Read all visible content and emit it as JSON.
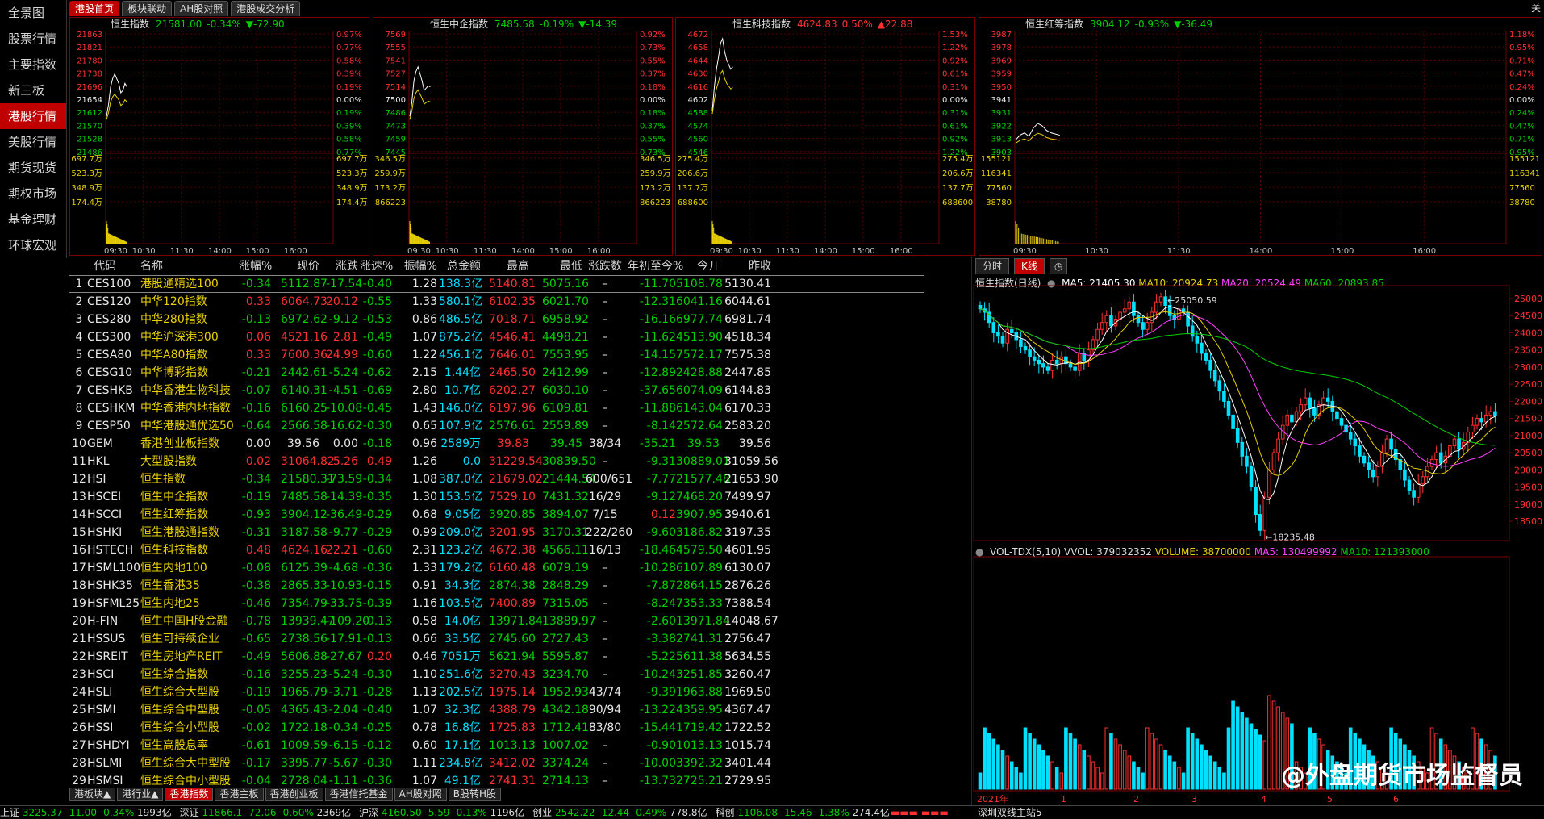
{
  "nav": [
    "全景图",
    "股票行情",
    "主要指数",
    "新三板",
    "港股行情",
    "美股行情",
    "期货现货",
    "期权市场",
    "基金理财",
    "环球宏观"
  ],
  "nav_active": 4,
  "top_tabs": [
    "港股首页",
    "板块联动",
    "AH股对照",
    "港股成交分析"
  ],
  "top_tabs_active": 0,
  "top_right": "关",
  "minis": [
    {
      "name": "恒生指数",
      "last": "21581.00",
      "pct": "-0.34%",
      "chg": "▼-72.90",
      "up": false,
      "prices": [
        "21863",
        "21821",
        "21780",
        "21738",
        "21696",
        "21654",
        "21612",
        "21570",
        "21528",
        "21486"
      ],
      "pcts": [
        "0.97%",
        "0.77%",
        "0.58%",
        "0.39%",
        "0.19%",
        "0.00%",
        "0.19%",
        "0.39%",
        "0.58%",
        "0.77%"
      ],
      "vols": [
        "697.7万",
        "523.3万",
        "348.9万",
        "174.4万"
      ],
      "times": [
        "09:30",
        "10:30",
        "11:30",
        "14:00",
        "15:00",
        "16:00"
      ],
      "line": [
        0.3,
        0.4,
        0.55,
        0.62,
        0.66,
        0.62,
        0.58,
        0.5,
        0.52,
        0.58,
        0.55
      ]
    },
    {
      "name": "恒生中企指数",
      "last": "7485.58",
      "pct": "-0.19%",
      "chg": "▼-14.39",
      "up": false,
      "prices": [
        "7569",
        "7555",
        "7541",
        "7527",
        "7514",
        "7500",
        "7486",
        "7473",
        "7459",
        "7445"
      ],
      "pcts": [
        "0.92%",
        "0.73%",
        "0.55%",
        "0.37%",
        "0.18%",
        "0.00%",
        "0.18%",
        "0.37%",
        "0.55%",
        "0.73%"
      ],
      "vols": [
        "346.5万",
        "259.9万",
        "173.2万",
        "866223"
      ],
      "times": [
        "09:30",
        "10:30",
        "11:30",
        "14:00",
        "15:00",
        "16:00"
      ],
      "line": [
        0.3,
        0.42,
        0.6,
        0.68,
        0.72,
        0.66,
        0.6,
        0.52,
        0.54,
        0.56,
        0.55
      ]
    },
    {
      "name": "恒生科技指数",
      "last": "4624.83",
      "pct": "0.50%",
      "chg": "▲22.88",
      "up": true,
      "prices": [
        "4672",
        "4658",
        "4644",
        "4630",
        "4616",
        "4602",
        "4588",
        "4574",
        "4560",
        "4546"
      ],
      "pcts": [
        "1.53%",
        "1.22%",
        "0.92%",
        "0.61%",
        "0.31%",
        "0.00%",
        "0.31%",
        "0.61%",
        "0.92%",
        "1.22%"
      ],
      "vols": [
        "275.4万",
        "206.6万",
        "137.7万",
        "688600"
      ],
      "times": [
        "09:30",
        "10:30",
        "11:30",
        "14:00",
        "15:00",
        "16:00"
      ],
      "line": [
        0.35,
        0.55,
        0.7,
        0.8,
        0.92,
        0.96,
        0.85,
        0.78,
        0.74,
        0.7,
        0.72
      ]
    },
    {
      "name": "恒生红筹指数",
      "last": "3904.12",
      "pct": "-0.93%",
      "chg": "▼-36.49",
      "up": false,
      "prices": [
        "3987",
        "3978",
        "3969",
        "3959",
        "3950",
        "3941",
        "3931",
        "3922",
        "3913",
        "3903"
      ],
      "pcts": [
        "1.18%",
        "0.95%",
        "0.71%",
        "0.47%",
        "0.24%",
        "0.00%",
        "0.24%",
        "0.47%",
        "0.71%",
        "0.95%"
      ],
      "vols": [
        "155121",
        "116341",
        "77560",
        "38780"
      ],
      "times": [
        "09:30",
        "10:30",
        "11:30",
        "14:00",
        "15:00",
        "16:00"
      ],
      "line": [
        0.1,
        0.14,
        0.16,
        0.13,
        0.2,
        0.24,
        0.22,
        0.18,
        0.16,
        0.15,
        0.14
      ]
    }
  ],
  "table": {
    "headers": [
      "",
      "代码",
      "名称",
      "涨幅%",
      "现价",
      "涨跌",
      "涨速%",
      "振幅%",
      "总金额",
      "最高",
      "最低",
      "涨跌数",
      "年初至今%",
      "今开",
      "昨收"
    ],
    "rows": [
      [
        "1",
        "CES100",
        "港股通精选100",
        "-0.34",
        "5112.87",
        "-17.54",
        "-0.40",
        "1.28",
        "138.3亿",
        "5140.81",
        "5075.16",
        "–",
        "-11.70",
        "5108.78",
        "5130.41"
      ],
      [
        "2",
        "CES120",
        "中华120指数",
        "0.33",
        "6064.73",
        "20.12",
        "-0.55",
        "1.33",
        "580.1亿",
        "6102.35",
        "6021.70",
        "–",
        "-12.31",
        "6041.16",
        "6044.61"
      ],
      [
        "3",
        "CES280",
        "中华280指数",
        "-0.13",
        "6972.62",
        "-9.12",
        "-0.53",
        "0.86",
        "486.5亿",
        "7018.71",
        "6958.92",
        "–",
        "-16.16",
        "6977.74",
        "6981.74"
      ],
      [
        "4",
        "CES300",
        "中华沪深港300",
        "0.06",
        "4521.16",
        "2.81",
        "-0.49",
        "1.07",
        "875.2亿",
        "4546.41",
        "4498.21",
        "–",
        "-11.62",
        "4513.90",
        "4518.34"
      ],
      [
        "5",
        "CESA80",
        "中华A80指数",
        "0.33",
        "7600.36",
        "24.99",
        "-0.60",
        "1.22",
        "456.1亿",
        "7646.01",
        "7553.95",
        "–",
        "-14.15",
        "7572.17",
        "7575.38"
      ],
      [
        "6",
        "CESG10",
        "中华博彩指数",
        "-0.21",
        "2442.61",
        "-5.24",
        "-0.62",
        "2.15",
        "1.44亿",
        "2465.50",
        "2412.99",
        "–",
        "-12.89",
        "2428.88",
        "2447.85"
      ],
      [
        "7",
        "CESHKB",
        "中华香港生物科技",
        "-0.07",
        "6140.31",
        "-4.51",
        "-0.69",
        "2.80",
        "10.7亿",
        "6202.27",
        "6030.10",
        "–",
        "-37.65",
        "6074.09",
        "6144.83"
      ],
      [
        "8",
        "CESHKM",
        "中华香港内地指数",
        "-0.16",
        "6160.25",
        "-10.08",
        "-0.45",
        "1.43",
        "146.0亿",
        "6197.96",
        "6109.81",
        "–",
        "-11.88",
        "6143.04",
        "6170.33"
      ],
      [
        "9",
        "CESP50",
        "中华港股通优选50",
        "-0.64",
        "2566.58",
        "-16.62",
        "-0.30",
        "0.65",
        "107.9亿",
        "2576.61",
        "2559.89",
        "–",
        "-8.14",
        "2572.64",
        "2583.20"
      ],
      [
        "10",
        "GEM",
        "香港创业板指数",
        "0.00",
        "39.56",
        "0.00",
        "-0.18",
        "0.96",
        "2589万",
        "39.83",
        "39.45",
        "38/34",
        "-35.21",
        "39.53",
        "39.56"
      ],
      [
        "11",
        "HKL",
        "大型股指数",
        "0.02",
        "31064.82",
        "5.26",
        "0.49",
        "1.26",
        "0.0",
        "31229.54",
        "30839.50",
        "–",
        "-9.31",
        "30889.01",
        "31059.56"
      ],
      [
        "12",
        "HSI",
        "恒生指数",
        "-0.34",
        "21580.31",
        "-73.59",
        "-0.34",
        "1.08",
        "387.0亿",
        "21679.02",
        "21444.54",
        "600/651",
        "-7.77",
        "21577.48",
        "21653.90"
      ],
      [
        "13",
        "HSCEI",
        "恒生中企指数",
        "-0.19",
        "7485.58",
        "-14.39",
        "-0.35",
        "1.30",
        "153.5亿",
        "7529.10",
        "7431.32",
        "16/29",
        "-9.12",
        "7468.20",
        "7499.97"
      ],
      [
        "14",
        "HSCCI",
        "恒生红筹指数",
        "-0.93",
        "3904.12",
        "-36.49",
        "-0.29",
        "0.68",
        "9.05亿",
        "3920.85",
        "3894.07",
        "7/15",
        "0.12",
        "3907.95",
        "3940.61"
      ],
      [
        "15",
        "HSHKI",
        "恒生港股通指数",
        "-0.31",
        "3187.58",
        "-9.77",
        "-0.29",
        "0.99",
        "209.0亿",
        "3201.95",
        "3170.31",
        "222/260",
        "-9.60",
        "3186.82",
        "3197.35"
      ],
      [
        "16",
        "HSTECH",
        "恒生科技指数",
        "0.48",
        "4624.16",
        "22.21",
        "-0.60",
        "2.31",
        "123.2亿",
        "4672.38",
        "4566.11",
        "16/13",
        "-18.46",
        "4579.50",
        "4601.95"
      ],
      [
        "17",
        "HSML100",
        "恒生内地100",
        "-0.08",
        "6125.39",
        "-4.68",
        "-0.36",
        "1.33",
        "179.2亿",
        "6160.48",
        "6079.19",
        "–",
        "-10.28",
        "6107.89",
        "6130.07"
      ],
      [
        "18",
        "HSHK35",
        "恒生香港35",
        "-0.38",
        "2865.33",
        "-10.93",
        "-0.15",
        "0.91",
        "34.3亿",
        "2874.38",
        "2848.29",
        "–",
        "-7.87",
        "2864.15",
        "2876.26"
      ],
      [
        "19",
        "HSFML25",
        "恒生内地25",
        "-0.46",
        "7354.79",
        "-33.75",
        "-0.39",
        "1.16",
        "103.5亿",
        "7400.89",
        "7315.05",
        "–",
        "-8.24",
        "7353.33",
        "7388.54"
      ],
      [
        "20",
        "H-FIN",
        "恒生中国H股金融",
        "-0.78",
        "13939.47",
        "-109.20",
        "-0.13",
        "0.58",
        "14.0亿",
        "13971.84",
        "13889.97",
        "–",
        "-2.60",
        "13971.84",
        "14048.67"
      ],
      [
        "21",
        "HSSUS",
        "恒生可持续企业",
        "-0.65",
        "2738.56",
        "-17.91",
        "-0.13",
        "0.66",
        "33.5亿",
        "2745.60",
        "2727.43",
        "–",
        "-3.38",
        "2741.31",
        "2756.47"
      ],
      [
        "22",
        "HSREIT",
        "恒生房地产REIT",
        "-0.49",
        "5606.88",
        "-27.67",
        "0.20",
        "0.46",
        "7051万",
        "5621.94",
        "5595.87",
        "–",
        "-5.22",
        "5611.38",
        "5634.55"
      ],
      [
        "23",
        "HSCI",
        "恒生综合指数",
        "-0.16",
        "3255.23",
        "-5.24",
        "-0.30",
        "1.10",
        "251.6亿",
        "3270.43",
        "3234.70",
        "–",
        "-10.24",
        "3251.85",
        "3260.47"
      ],
      [
        "24",
        "HSLI",
        "恒生综合大型股",
        "-0.19",
        "1965.79",
        "-3.71",
        "-0.28",
        "1.13",
        "202.5亿",
        "1975.14",
        "1952.93",
        "43/74",
        "-9.39",
        "1963.88",
        "1969.50"
      ],
      [
        "25",
        "HSMI",
        "恒生综合中型股",
        "-0.05",
        "4365.43",
        "-2.04",
        "-0.40",
        "1.07",
        "32.3亿",
        "4388.79",
        "4342.18",
        "90/94",
        "-13.22",
        "4359.95",
        "4367.47"
      ],
      [
        "26",
        "HSSI",
        "恒生综合小型股",
        "-0.02",
        "1722.18",
        "-0.34",
        "-0.25",
        "0.78",
        "16.8亿",
        "1725.83",
        "1712.41",
        "83/80",
        "-15.44",
        "1719.42",
        "1722.52"
      ],
      [
        "27",
        "HSHDYI",
        "恒生高股息率",
        "-0.61",
        "1009.59",
        "-6.15",
        "-0.12",
        "0.60",
        "17.1亿",
        "1013.13",
        "1007.02",
        "–",
        "-0.90",
        "1013.13",
        "1015.74"
      ],
      [
        "28",
        "HSLMI",
        "恒生综合大中型股",
        "-0.17",
        "3395.77",
        "-5.67",
        "-0.30",
        "1.11",
        "234.8亿",
        "3412.02",
        "3374.24",
        "–",
        "-10.00",
        "3392.32",
        "3401.44"
      ],
      [
        "29",
        "HSMSI",
        "恒生综合中小型股",
        "-0.04",
        "2728.04",
        "-1.11",
        "-0.36",
        "1.07",
        "49.1亿",
        "2741.31",
        "2714.13",
        "–",
        "-13.73",
        "2725.21",
        "2729.95"
      ]
    ]
  },
  "bottom_tabs": [
    "港板块▲",
    "港行业▲",
    "香港指数",
    "香港主板",
    "香港创业板",
    "香港信托基金",
    "AH股对照",
    "B股转H股"
  ],
  "bottom_tabs_active": 2,
  "status": [
    {
      "label": "上证",
      "v": "3225.37",
      "c": "-11.00",
      "p": "-0.34%",
      "a": "1993亿"
    },
    {
      "label": "深证",
      "v": "11866.1",
      "c": "-72.06",
      "p": "-0.60%",
      "a": "2369亿"
    },
    {
      "label": "沪深",
      "v": "4160.50",
      "c": "-5.59",
      "p": "-0.13%",
      "a": "1196亿"
    },
    {
      "label": "创业",
      "v": "2542.22",
      "c": "-12.44",
      "p": "-0.49%",
      "a": "778.8亿"
    },
    {
      "label": "科创",
      "v": "1106.08",
      "c": "-15.46",
      "p": "-1.38%",
      "a": "274.4亿"
    }
  ],
  "status_right": "深圳双线主站5",
  "right_chart": {
    "tab_minute": "分时",
    "tab_kline": "K线",
    "title": "恒生指数(日线)",
    "ma": [
      {
        "t": "MA5: 21405.30",
        "color": "#ffffff"
      },
      {
        "t": "MA10: 20924.73",
        "color": "#e8d000"
      },
      {
        "t": "MA20: 20524.49",
        "color": "#ff40ff"
      },
      {
        "t": "MA60: 20893.85",
        "color": "#00d000"
      }
    ],
    "y_ticks": [
      "25000",
      "24500",
      "24000",
      "23500",
      "23000",
      "22500",
      "22000",
      "21500",
      "21000",
      "20500",
      "20000",
      "19500",
      "19000",
      "18500"
    ],
    "high_label": "25050.59",
    "low_label": "18235.48",
    "vol_title": "VOL-TDX(5,10)",
    "vvol": "VVOL: 379032352",
    "volume": "VOLUME: 38700000",
    "vma5": "MA5: 130499992",
    "vma10": "MA10: 121393000",
    "x_labels": [
      "2021年",
      "1",
      "2",
      "3",
      "4",
      "5",
      "6"
    ]
  },
  "watermark": "@外盘期货市场监督员"
}
